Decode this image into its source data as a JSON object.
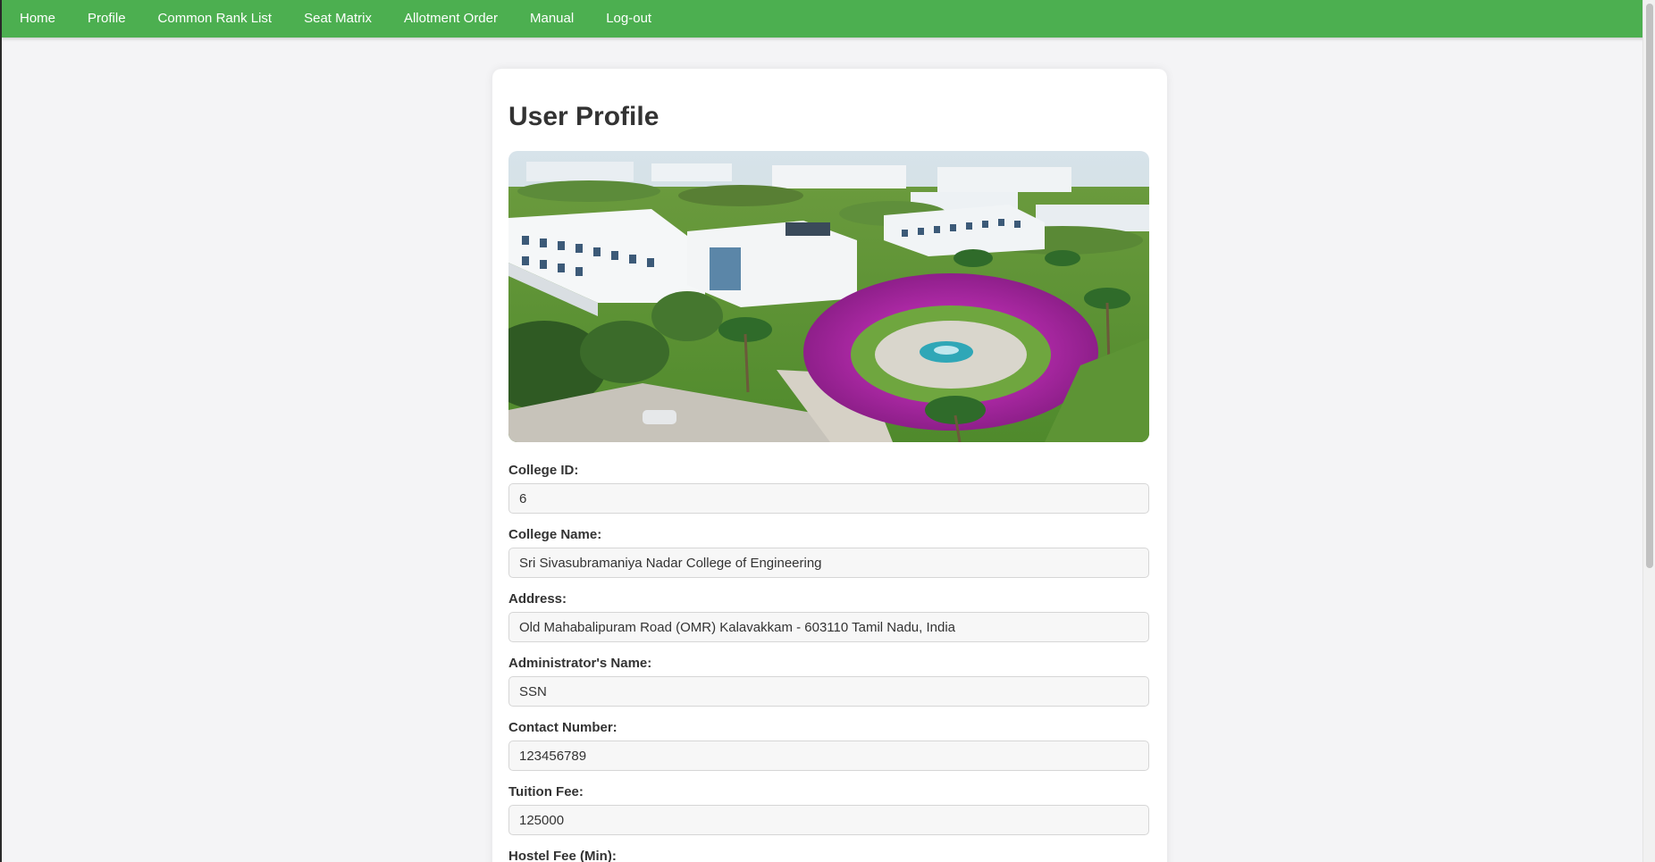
{
  "nav": {
    "items": [
      {
        "label": "Home"
      },
      {
        "label": "Profile"
      },
      {
        "label": "Common Rank List"
      },
      {
        "label": "Seat Matrix"
      },
      {
        "label": "Allotment Order"
      },
      {
        "label": "Manual"
      },
      {
        "label": "Log-out"
      }
    ]
  },
  "page": {
    "title": "User Profile"
  },
  "profile": {
    "fields": [
      {
        "label": "College ID:",
        "value": "6"
      },
      {
        "label": "College Name:",
        "value": "Sri Sivasubramaniya Nadar College of Engineering"
      },
      {
        "label": "Address:",
        "value": "Old Mahabalipuram Road (OMR) Kalavakkam - 603110 Tamil Nadu, India"
      },
      {
        "label": "Administrator's Name:",
        "value": "SSN"
      },
      {
        "label": "Contact Number:",
        "value": "123456789"
      },
      {
        "label": "Tuition Fee:",
        "value": "125000"
      },
      {
        "label": "Hostel Fee (Min):",
        "value": ""
      }
    ]
  },
  "colors": {
    "nav_bg": "#4caf50",
    "page_bg": "#f4f4f6",
    "card_bg": "#ffffff",
    "input_bg": "#f7f7f7"
  },
  "icons": {
    "hero_image": "campus-aerial-photo"
  }
}
